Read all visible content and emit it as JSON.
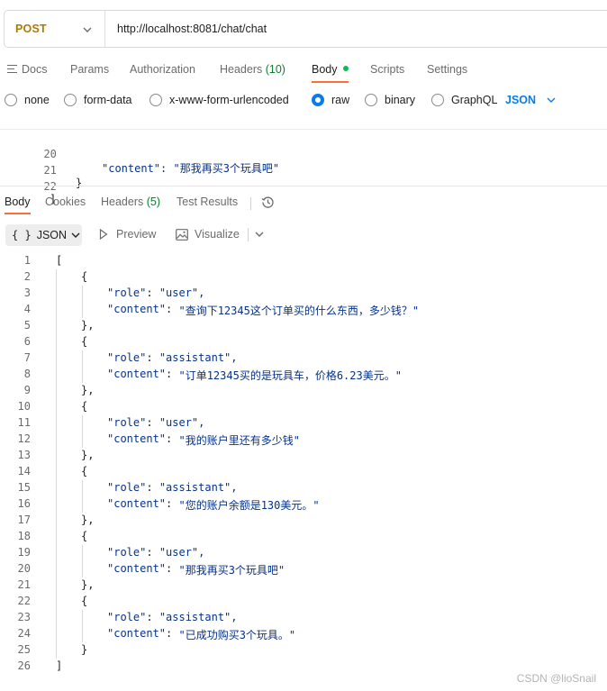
{
  "request": {
    "method": "POST",
    "url": "http://localhost:8081/chat/chat"
  },
  "request_tabs": [
    {
      "label": "Docs"
    },
    {
      "label": "Params"
    },
    {
      "label": "Authorization"
    },
    {
      "label": "Headers",
      "count": "(10)"
    },
    {
      "label": "Body",
      "active": true
    },
    {
      "label": "Scripts"
    },
    {
      "label": "Settings"
    }
  ],
  "body_types": [
    {
      "label": "none"
    },
    {
      "label": "form-data"
    },
    {
      "label": "x-www-form-urlencoded"
    },
    {
      "label": "raw",
      "selected": true
    },
    {
      "label": "binary"
    },
    {
      "label": "GraphQL"
    }
  ],
  "body_format": "JSON",
  "request_body_lines": [
    {
      "num": "20",
      "text": "\"content\": \"那我再买3个玩具吧\""
    },
    {
      "num": "21",
      "text": "}"
    },
    {
      "num": "22",
      "text": "]"
    }
  ],
  "response_tabs": [
    {
      "label": "Body",
      "active": true
    },
    {
      "label": "Cookies"
    },
    {
      "label": "Headers",
      "count": "(5)"
    },
    {
      "label": "Test Results"
    }
  ],
  "response_toolbar": {
    "format": "JSON",
    "preview": "Preview",
    "visualize": "Visualize"
  },
  "response_lines": [
    {
      "num": "1",
      "text": "["
    },
    {
      "num": "2",
      "text": "{"
    },
    {
      "num": "3",
      "key": "\"role\"",
      "value": "\"user\","
    },
    {
      "num": "4",
      "key": "\"content\"",
      "value": "\"查询下12345这个订单买的什么东西，多少钱？\""
    },
    {
      "num": "5",
      "text": "},"
    },
    {
      "num": "6",
      "text": "{"
    },
    {
      "num": "7",
      "key": "\"role\"",
      "value": "\"assistant\","
    },
    {
      "num": "8",
      "key": "\"content\"",
      "value": "\"订单12345买的是玩具车，价格6.23美元。\""
    },
    {
      "num": "9",
      "text": "},"
    },
    {
      "num": "10",
      "text": "{"
    },
    {
      "num": "11",
      "key": "\"role\"",
      "value": "\"user\","
    },
    {
      "num": "12",
      "key": "\"content\"",
      "value": "\"我的账户里还有多少钱\""
    },
    {
      "num": "13",
      "text": "},"
    },
    {
      "num": "14",
      "text": "{"
    },
    {
      "num": "15",
      "key": "\"role\"",
      "value": "\"assistant\","
    },
    {
      "num": "16",
      "key": "\"content\"",
      "value": "\"您的账户余额是130美元。\""
    },
    {
      "num": "17",
      "text": "},"
    },
    {
      "num": "18",
      "text": "{"
    },
    {
      "num": "19",
      "key": "\"role\"",
      "value": "\"user\","
    },
    {
      "num": "20",
      "key": "\"content\"",
      "value": "\"那我再买3个玩具吧\""
    },
    {
      "num": "21",
      "text": "},"
    },
    {
      "num": "22",
      "text": "{"
    },
    {
      "num": "23",
      "key": "\"role\"",
      "value": "\"assistant\","
    },
    {
      "num": "24",
      "key": "\"content\"",
      "value": "\"已成功购买3个玩具。\""
    },
    {
      "num": "25",
      "text": "}"
    },
    {
      "num": "26",
      "text": "]"
    }
  ],
  "watermark": "CSDN @lioSnail",
  "colors": {
    "method": "#ad7a03",
    "accent": "#ff6c37",
    "link": "#097bed",
    "string": "#063289",
    "count": "#0c7d2f"
  }
}
